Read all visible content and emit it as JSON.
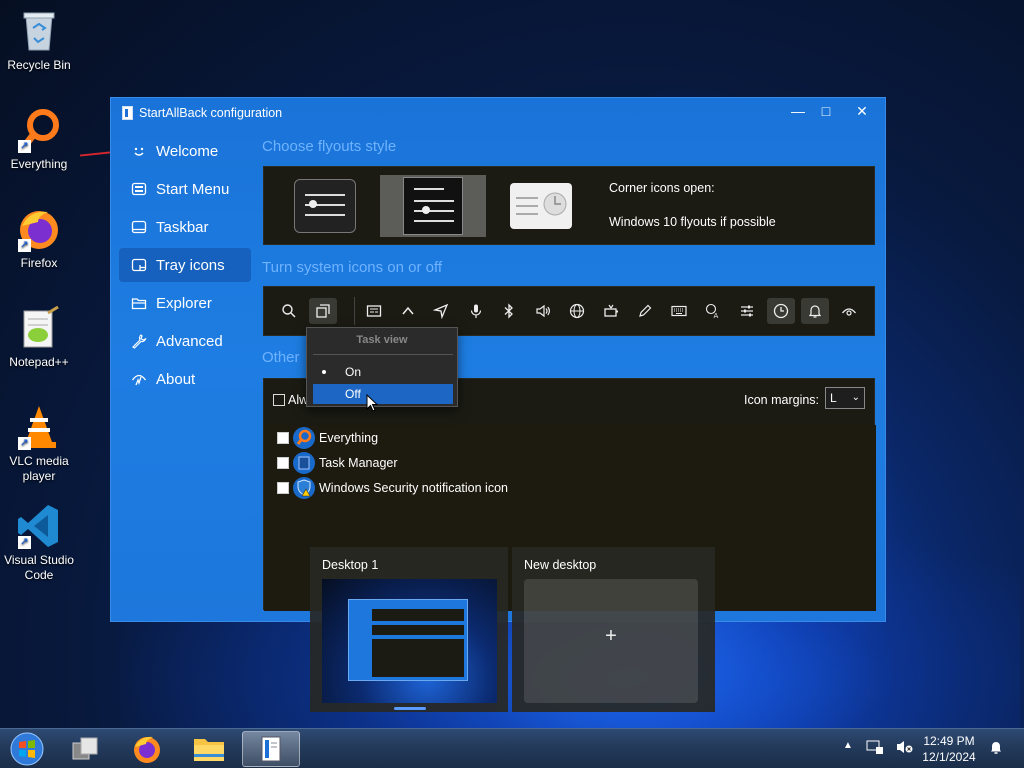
{
  "desktop": {
    "icons": [
      {
        "label": "Recycle Bin"
      },
      {
        "label": "Everything"
      },
      {
        "label": "Firefox"
      },
      {
        "label": "Notepad++"
      },
      {
        "label": "VLC media player"
      },
      {
        "label": "Visual Studio Code"
      }
    ]
  },
  "window": {
    "title": "StartAllBack configuration",
    "nav": [
      {
        "label": "Welcome",
        "icon": "smiley-icon"
      },
      {
        "label": "Start Menu",
        "icon": "start-menu-icon"
      },
      {
        "label": "Taskbar",
        "icon": "taskbar-icon"
      },
      {
        "label": "Tray icons",
        "icon": "tray-icon"
      },
      {
        "label": "Explorer",
        "icon": "folder-icon"
      },
      {
        "label": "Advanced",
        "icon": "wrench-icon"
      },
      {
        "label": "About",
        "icon": "about-icon"
      }
    ],
    "active_nav": "Tray icons",
    "flyouts": {
      "title": "Choose flyouts style",
      "corner_label": "Corner icons open:",
      "corner_value": "Windows 10 flyouts if possible"
    },
    "system_icons": {
      "title": "Turn system icons on or off"
    },
    "task_view_menu": {
      "header": "Task view",
      "items": [
        {
          "label": "On",
          "selected": true
        },
        {
          "label": "Off",
          "highlighted": true
        }
      ]
    },
    "other": {
      "title": "Other",
      "always_label": "Alw",
      "icon_margins_label": "Icon margins:",
      "icon_margins_value": "L",
      "apps": [
        {
          "label": "Everything"
        },
        {
          "label": "Task Manager"
        },
        {
          "label": "Windows Security notification icon"
        }
      ]
    }
  },
  "task_view": {
    "desktop1": "Desktop 1",
    "new_desktop": "New desktop",
    "plus": "+"
  },
  "taskbar": {
    "time": "12:49 PM",
    "date": "12/1/2024"
  },
  "colors": {
    "accent": "#1d77dc",
    "selection": "#1d66c4",
    "section_title": "#6fb3ff"
  }
}
